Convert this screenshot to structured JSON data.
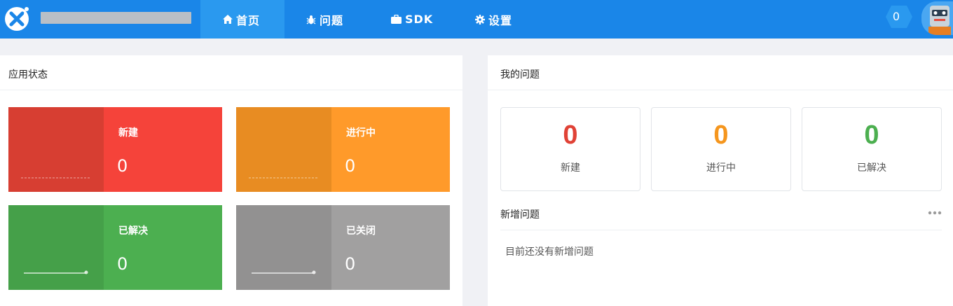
{
  "header": {
    "nav": [
      {
        "label": "首页",
        "icon": "home-icon"
      },
      {
        "label": "问题",
        "icon": "bug-icon"
      },
      {
        "label": "SDK",
        "icon": "briefcase-icon"
      },
      {
        "label": "设置",
        "icon": "gear-icon"
      }
    ],
    "notification_count": "0",
    "colors": {
      "bar": "#1a86e8",
      "active_tab": "#2a99ef"
    }
  },
  "app_status": {
    "title": "应用状态",
    "tiles": [
      {
        "label": "新建",
        "value": "0",
        "color": "#f5433a",
        "dark": "#d73e32"
      },
      {
        "label": "进行中",
        "value": "0",
        "color": "#ff9a2a",
        "dark": "#e88c22"
      },
      {
        "label": "已解决",
        "value": "0",
        "color": "#4caf50",
        "dark": "#45a049"
      },
      {
        "label": "已关闭",
        "value": "0",
        "color": "#a1a0a0",
        "dark": "#929191"
      }
    ]
  },
  "my_issues": {
    "title": "我的问题",
    "stats": [
      {
        "label": "新建",
        "value": "0",
        "color": "#e04236"
      },
      {
        "label": "进行中",
        "value": "0",
        "color": "#f5961e"
      },
      {
        "label": "已解决",
        "value": "0",
        "color": "#4caf50"
      }
    ],
    "new_issues": {
      "title": "新增问题",
      "empty_text": "目前还没有新增问题"
    }
  }
}
